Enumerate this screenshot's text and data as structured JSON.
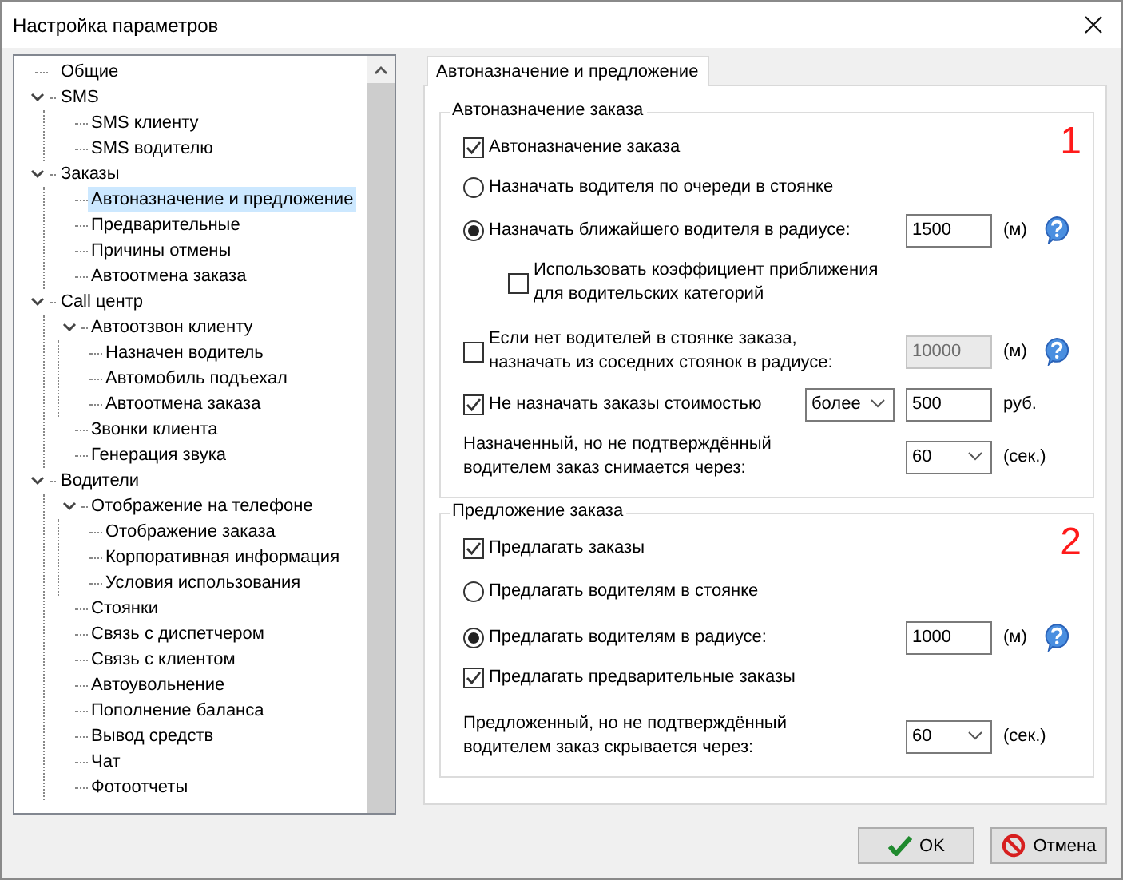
{
  "window": {
    "title": "Настройка параметров"
  },
  "tree": {
    "items": [
      {
        "label": "Общие",
        "selected": false
      },
      {
        "label": "SMS",
        "selected": false,
        "expanded": true,
        "children": [
          {
            "label": "SMS клиенту",
            "selected": false
          },
          {
            "label": "SMS водителю",
            "selected": false
          }
        ]
      },
      {
        "label": "Заказы",
        "selected": false,
        "expanded": true,
        "children": [
          {
            "label": "Автоназначение и предложение",
            "selected": true
          },
          {
            "label": "Предварительные",
            "selected": false
          },
          {
            "label": "Причины отмены",
            "selected": false
          },
          {
            "label": "Автоотмена заказа",
            "selected": false
          }
        ]
      },
      {
        "label": "Call центр",
        "selected": false,
        "expanded": true,
        "children": [
          {
            "label": "Автоотзвон клиенту",
            "selected": false,
            "expanded": true,
            "children": [
              {
                "label": "Назначен водитель",
                "selected": false
              },
              {
                "label": "Автомобиль подъехал",
                "selected": false
              },
              {
                "label": "Автоотмена заказа",
                "selected": false
              }
            ]
          },
          {
            "label": "Звонки клиента",
            "selected": false
          },
          {
            "label": "Генерация звука",
            "selected": false
          }
        ]
      },
      {
        "label": "Водители",
        "selected": false,
        "expanded": true,
        "children": [
          {
            "label": "Отображение на телефоне",
            "selected": false,
            "expanded": true,
            "children": [
              {
                "label": "Отображение заказа",
                "selected": false
              },
              {
                "label": "Корпоративная информация",
                "selected": false
              },
              {
                "label": "Условия использования",
                "selected": false
              }
            ]
          },
          {
            "label": "Стоянки",
            "selected": false
          },
          {
            "label": "Связь с диспетчером",
            "selected": false
          },
          {
            "label": "Связь с клиентом",
            "selected": false
          },
          {
            "label": "Автоувольнение",
            "selected": false
          },
          {
            "label": "Пополнение баланса",
            "selected": false
          },
          {
            "label": "Вывод средств",
            "selected": false
          },
          {
            "label": "Чат",
            "selected": false
          },
          {
            "label": "Фотоотчеты",
            "selected": false
          }
        ]
      }
    ]
  },
  "tabs": [
    {
      "label": "Автоназначение и предложение",
      "selected": true
    }
  ],
  "groups": [
    {
      "title": "Автоназначение заказа",
      "badge": "1",
      "rows": [
        {
          "kind": "checkbox",
          "label": "Автоназначение заказа",
          "checked": true
        },
        {
          "kind": "radio",
          "label": "Назначать водителя по очереди в стоянке",
          "selected": false
        },
        {
          "kind": "radio",
          "label": "Назначать ближайшего водителя в радиусе:",
          "selected": true,
          "field": {
            "kind": "input",
            "value": "1500",
            "disabled": false
          },
          "unit": "(м)",
          "help": true,
          "children": [
            {
              "kind": "checkbox",
              "label": "Использовать коэффициент приближения\nдля водительских категорий",
              "checked": false
            }
          ]
        },
        {
          "kind": "checkbox",
          "label": "Если нет водителей в стоянке заказа,\nназначать из соседних стоянок в радиусе:",
          "checked": false,
          "field": {
            "kind": "input",
            "value": "10000",
            "disabled": true
          },
          "unit": "(м)",
          "help": true
        },
        {
          "kind": "checkbox",
          "label": "Не назначать заказы стоимостью",
          "checked": true,
          "select": {
            "value": "более"
          },
          "field": {
            "kind": "input",
            "value": "500",
            "disabled": false
          },
          "unit": "руб."
        },
        {
          "kind": "text",
          "label": "Назначенный, но не подтверждённый\nводителем заказ снимается через:",
          "field": {
            "kind": "dropdown",
            "value": "60",
            "disabled": false
          },
          "unit": "(сек.)"
        }
      ]
    },
    {
      "title": "Предложение заказа",
      "badge": "2",
      "rows": [
        {
          "kind": "checkbox",
          "label": "Предлагать заказы",
          "checked": true
        },
        {
          "kind": "radio",
          "label": "Предлагать водителям в стоянке",
          "selected": false
        },
        {
          "kind": "radio",
          "label": "Предлагать водителям в радиусе:",
          "selected": true,
          "field": {
            "kind": "input",
            "value": "1000",
            "disabled": false
          },
          "unit": "(м)",
          "help": true
        },
        {
          "kind": "checkbox",
          "label": "Предлагать предварительные заказы",
          "checked": true
        },
        {
          "kind": "text",
          "label": "Предложенный, но не подтверждённый\nводителем заказ скрывается через:",
          "field": {
            "kind": "dropdown",
            "value": "60",
            "disabled": false
          },
          "unit": "(сек.)"
        }
      ]
    }
  ],
  "buttons": [
    {
      "kind": "ok",
      "label": "OK"
    },
    {
      "kind": "cancel",
      "label": "Отмена"
    }
  ]
}
